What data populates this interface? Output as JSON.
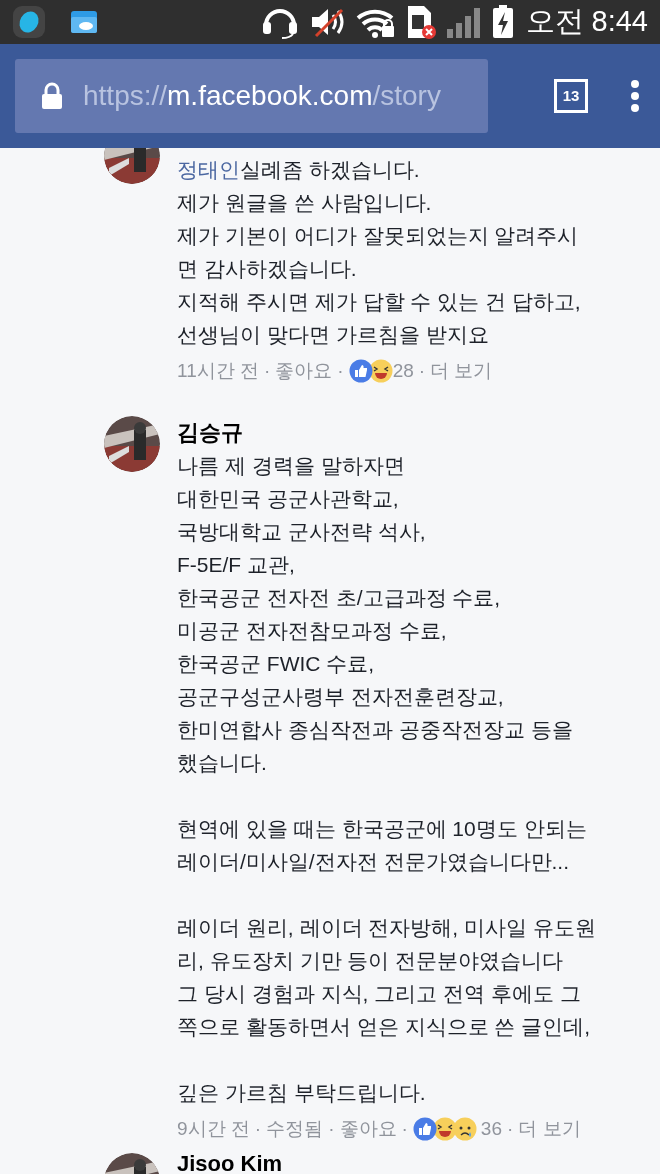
{
  "status_bar": {
    "time": "오전 8:44"
  },
  "browser": {
    "url": {
      "scheme": "https://",
      "host": "m.facebook.com",
      "path": "/story"
    },
    "tab_count": "13"
  },
  "comments": [
    {
      "mention": "정태인",
      "paragraphs": [
        [
          "실례좀 하겠습니다.",
          "제가 원글을 쓴 사람입니다.",
          "제가 기본이 어디가 잘못되었는지 알려주시",
          "면 감사하겠습니다.",
          "지적해 주시면 제가 답할 수 있는 건 답하고,",
          "선생님이 맞다면 가르침을 받지요"
        ]
      ],
      "meta": {
        "time": "11시간 전",
        "separator": "·",
        "like": "좋아요",
        "reactions": [
          {
            "kind": "like"
          },
          {
            "kind": "haha"
          }
        ],
        "reaction_count": "28",
        "more": "더 보기"
      }
    },
    {
      "author": "김승규",
      "paragraphs": [
        [
          "나름 제 경력을 말하자면",
          "대한민국 공군사관학교,",
          "국방대학교 군사전략 석사,",
          "F-5E/F 교관,",
          "한국공군 전자전 초/고급과정 수료,",
          "미공군 전자전참모과정 수료,",
          "한국공군 FWIC 수료,",
          "공군구성군사령부 전자전훈련장교,",
          "한미연합사 종심작전과 공중작전장교 등을",
          "했습니다."
        ],
        [
          "현역에 있을 때는 한국공군에 10명도 안되는",
          "레이더/미사일/전자전 전문가였습니다만..."
        ],
        [
          "레이더 원리, 레이더 전자방해, 미사일 유도원",
          "리, 유도장치 기만 등이 전문분야였습니다",
          "그 당시 경험과 지식, 그리고 전역 후에도 그",
          "쪽으로 활동하면서 얻은 지식으로 쓴 글인데,"
        ],
        [
          "깊은 가르침 부탁드립니다."
        ]
      ],
      "meta": {
        "time": "9시간 전",
        "separator": "·",
        "edited": "수정됨",
        "like": "좋아요",
        "reactions": [
          {
            "kind": "like"
          },
          {
            "kind": "haha"
          },
          {
            "kind": "sad"
          }
        ],
        "reaction_count": "36",
        "more": "더 보기"
      }
    },
    {
      "author": "Jisoo Kim"
    }
  ]
}
